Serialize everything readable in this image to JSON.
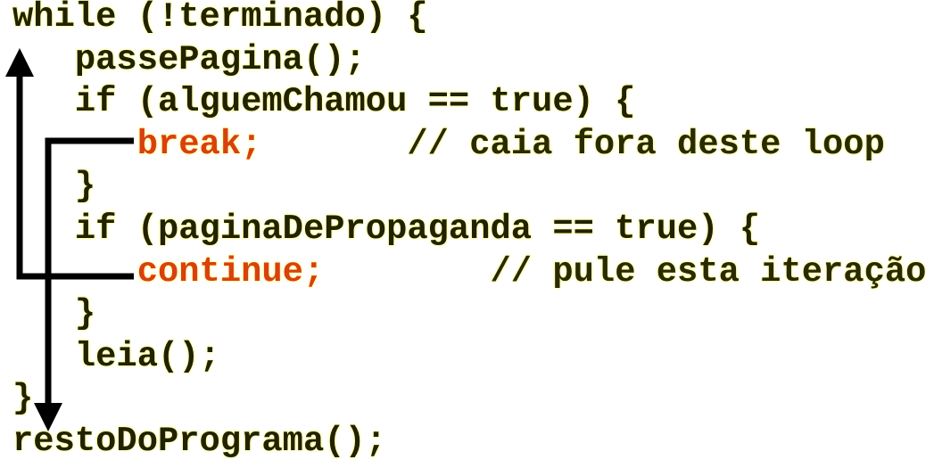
{
  "code": {
    "lines": [
      "while (!terminado) {",
      "   passePagina();",
      "   if (alguemChamou == true) {",
      "",
      "   }",
      "   if (paginaDePropaganda == true) {",
      "",
      "   }",
      "   leia();",
      "}",
      "restoDoPrograma();"
    ],
    "break_stmt": "break;",
    "break_comment": "// caia fora deste loop",
    "continue_stmt": "continue;",
    "continue_comment": "// pule esta iteração"
  },
  "colors": {
    "keyword": "#d9400f",
    "text": "#222200",
    "arrow": "#000000"
  }
}
